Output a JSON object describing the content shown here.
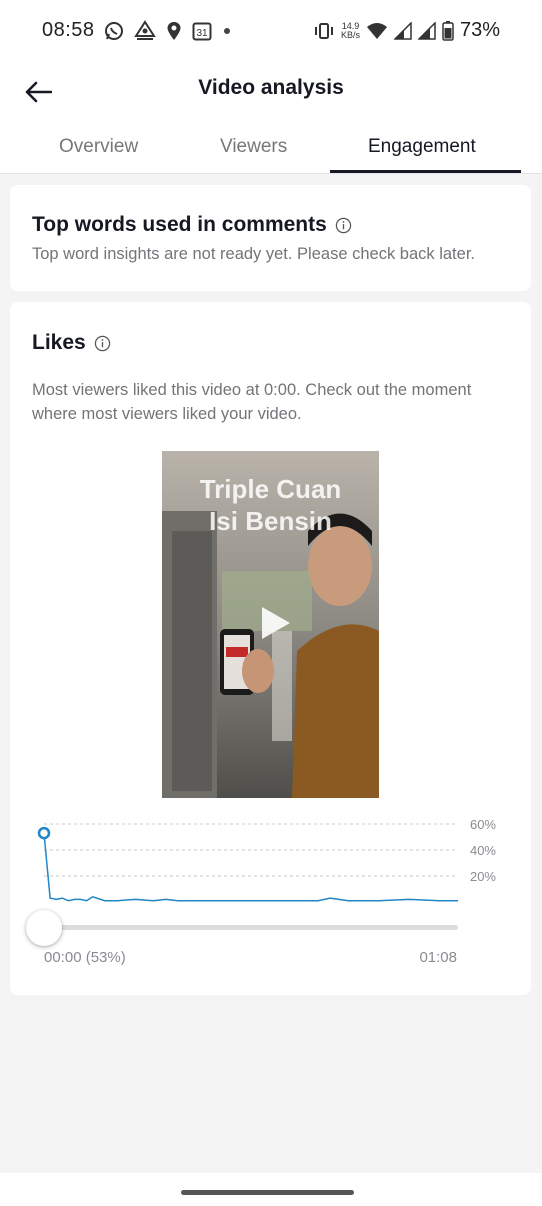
{
  "status_bar": {
    "time": "08:58",
    "network_speed": "14.9",
    "network_unit": "KB/s",
    "battery": "73%",
    "icons": [
      "whatsapp-icon",
      "airvpn-icon",
      "location-icon",
      "calendar-icon",
      "dot-icon",
      "vibrate-icon",
      "wifi-icon",
      "signal-icon",
      "signal-icon",
      "battery-icon"
    ],
    "calendar_day": "31"
  },
  "header": {
    "title": "Video analysis"
  },
  "tabs": [
    {
      "label": "Overview",
      "active": false
    },
    {
      "label": "Viewers",
      "active": false
    },
    {
      "label": "Engagement",
      "active": true
    }
  ],
  "top_words": {
    "title": "Top words used in comments",
    "message": "Top word insights are not ready yet. Please check back later."
  },
  "likes": {
    "title": "Likes",
    "description": "Most viewers liked this video at 0:00. Check out the moment where most viewers liked your video.",
    "video_caption_line1": "Triple Cuan",
    "video_caption_line2": "Isi Bensin",
    "accent_color": "#1f86c7"
  },
  "chart_data": {
    "type": "line",
    "y_ticks": [
      "60%",
      "40%",
      "20%"
    ],
    "ylim": [
      0,
      60
    ],
    "x": [
      0,
      1,
      2,
      3,
      4,
      5,
      6,
      7,
      8,
      10,
      12,
      15,
      18,
      20,
      22,
      24,
      26,
      30,
      35,
      40,
      45,
      47,
      50,
      55,
      60,
      65,
      68
    ],
    "values": [
      53,
      3,
      2,
      3,
      1,
      2,
      2,
      1,
      4,
      1,
      1,
      2,
      1,
      2,
      1,
      1,
      1,
      1,
      1,
      1,
      1,
      3,
      1,
      1,
      2,
      1,
      1
    ],
    "series_color": "#1f86c7",
    "start_label": "00:00 (53%)",
    "end_label": "01:08",
    "slider_position": 0
  }
}
